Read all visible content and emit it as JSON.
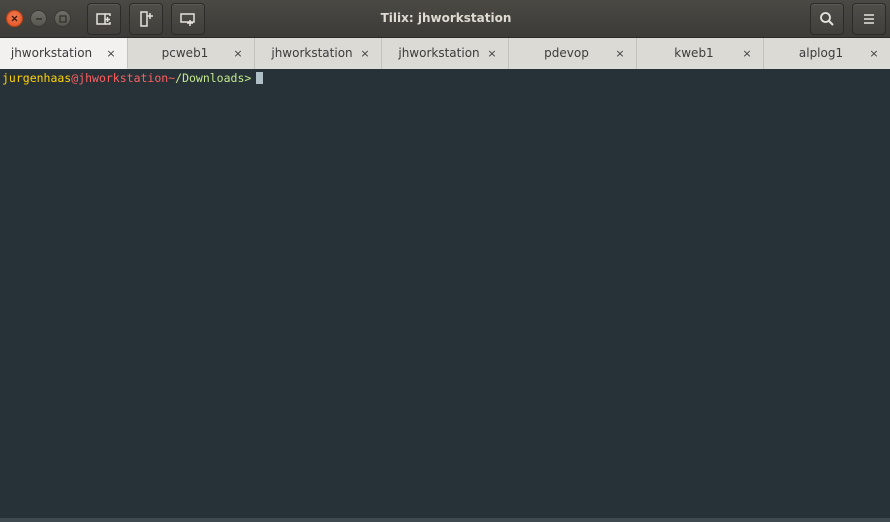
{
  "window": {
    "title": "Tilix: jhworkstation"
  },
  "toolbar": {
    "buttons": [
      {
        "icon": "add-terminal-right-icon"
      },
      {
        "icon": "add-terminal-down-icon"
      },
      {
        "icon": "add-session-icon"
      }
    ],
    "search_icon": "search-icon",
    "menu_icon": "hamburger-menu-icon"
  },
  "tabs": [
    {
      "label": "jhworkstation",
      "close": "×",
      "active": true
    },
    {
      "label": "pcweb1",
      "close": "×",
      "active": false
    },
    {
      "label": "jhworkstation",
      "close": "×",
      "active": false
    },
    {
      "label": "jhworkstation",
      "close": "×",
      "active": false
    },
    {
      "label": "pdevop",
      "close": "×",
      "active": false
    },
    {
      "label": "kweb1",
      "close": "×",
      "active": false
    },
    {
      "label": "alplog1",
      "close": "×",
      "active": false
    }
  ],
  "terminal": {
    "user": "jurgenhaas",
    "at": "@",
    "host": "jhworkstation",
    "tilde": "~",
    "path": "/Downloads",
    "symbol": ">"
  },
  "colors": {
    "terminal_bg": "#263238",
    "user": "#ffd204",
    "host": "#ff5f5f",
    "path": "#c3e88d"
  }
}
